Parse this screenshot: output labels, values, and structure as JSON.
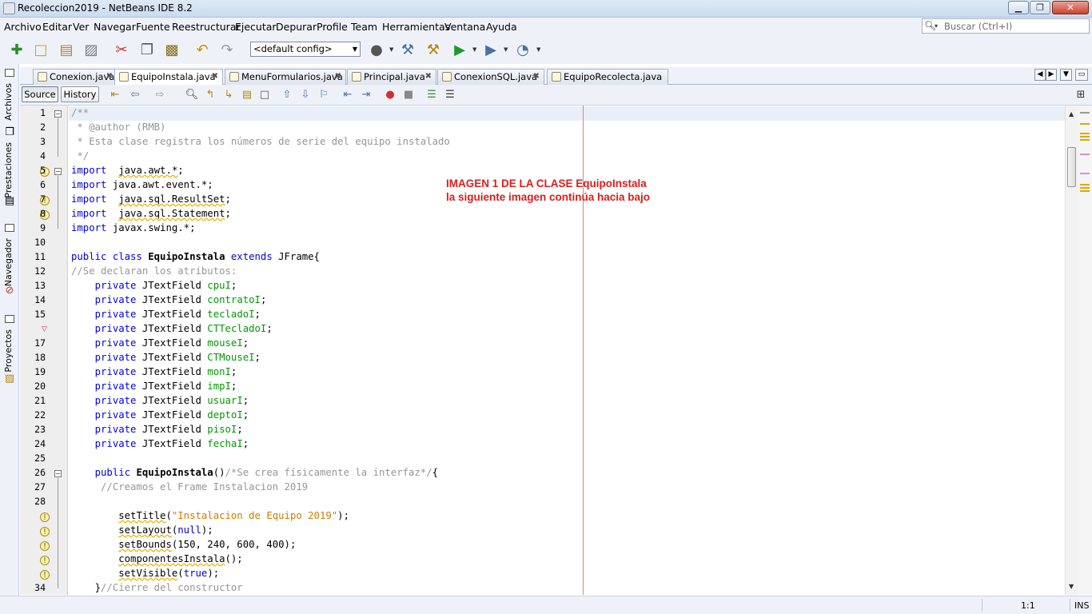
{
  "window": {
    "title": "Recoleccion2019 - NetBeans IDE 8.2",
    "min_label": "▁",
    "max_label": "❐",
    "close_label": "✕"
  },
  "menu": [
    "Archivo",
    "Editar",
    "Ver",
    "Navegar",
    "Fuente",
    "Reestructurar",
    "Ejecutar",
    "Depurar",
    "Profile",
    "Team",
    "Herramientas",
    "Ventana",
    "Ayuda"
  ],
  "search": {
    "placeholder": "Buscar (Ctrl+I)"
  },
  "toolbar": {
    "config": "<default config>"
  },
  "side_tabs": [
    "Archivos",
    "Prestaciones",
    "Navegador",
    "Proyectos"
  ],
  "tabs": [
    {
      "label": "Conexion.java"
    },
    {
      "label": "EquipoInstala.java",
      "active": true
    },
    {
      "label": "MenuFormularios.java"
    },
    {
      "label": "Principal.java"
    },
    {
      "label": "ConexionSQL.java"
    },
    {
      "label": "EquipoRecolecta.java"
    }
  ],
  "editor": {
    "source_label": "Source",
    "history_label": "History"
  },
  "code_lines": [
    {
      "n": "1",
      "t": [
        [
          "cm",
          "/**"
        ]
      ]
    },
    {
      "n": "2",
      "t": [
        [
          "cm",
          " * @author (RMB)"
        ]
      ]
    },
    {
      "n": "3",
      "t": [
        [
          "cm",
          " * Esta clase registra los números de serie del equipo instalado"
        ]
      ]
    },
    {
      "n": "4",
      "t": [
        [
          "cm",
          " */"
        ]
      ]
    },
    {
      "n": "5",
      "t": [
        [
          "kw",
          "import"
        ],
        [
          "",
          "  "
        ],
        [
          "wave",
          "java.awt.*"
        ],
        [
          "",
          ";"
        ]
      ]
    },
    {
      "n": "6",
      "t": [
        [
          "kw",
          "import"
        ],
        [
          "",
          " java.awt.event.*;"
        ]
      ]
    },
    {
      "n": "7",
      "t": [
        [
          "kw",
          "import"
        ],
        [
          "",
          "  "
        ],
        [
          "wave",
          "java.sql.ResultSet"
        ],
        [
          "",
          ";"
        ]
      ]
    },
    {
      "n": "8",
      "t": [
        [
          "kw",
          "import"
        ],
        [
          "",
          "  "
        ],
        [
          "wave",
          "java.sql.Statement"
        ],
        [
          "",
          ";"
        ]
      ]
    },
    {
      "n": "9",
      "t": [
        [
          "kw",
          "import"
        ],
        [
          "",
          " javax.swing.*;"
        ]
      ]
    },
    {
      "n": "10",
      "t": []
    },
    {
      "n": "11",
      "t": [
        [
          "kw",
          "public class "
        ],
        [
          "bold",
          "EquipoInstala"
        ],
        [
          "kw",
          " extends"
        ],
        [
          "",
          " JFrame{"
        ]
      ]
    },
    {
      "n": "12",
      "t": [
        [
          "cm",
          "//Se declaran los atributos:"
        ]
      ]
    },
    {
      "n": "13",
      "t": [
        [
          "",
          "    "
        ],
        [
          "kw",
          "private"
        ],
        [
          "",
          " JTextField "
        ],
        [
          "fld",
          "cpuI"
        ],
        [
          "",
          ";"
        ]
      ]
    },
    {
      "n": "14",
      "t": [
        [
          "",
          "    "
        ],
        [
          "kw",
          "private"
        ],
        [
          "",
          " JTextField "
        ],
        [
          "fld",
          "contratoI"
        ],
        [
          "",
          ";"
        ]
      ]
    },
    {
      "n": "15",
      "t": [
        [
          "",
          "    "
        ],
        [
          "kw",
          "private"
        ],
        [
          "",
          " JTextField "
        ],
        [
          "fld",
          "tecladoI"
        ],
        [
          "",
          ";"
        ]
      ]
    },
    {
      "n": "",
      "t": [
        [
          "",
          "    "
        ],
        [
          "kw",
          "private"
        ],
        [
          "",
          " JTextField "
        ],
        [
          "fld",
          "CTTecladoI"
        ],
        [
          "",
          ";"
        ]
      ]
    },
    {
      "n": "17",
      "t": [
        [
          "",
          "    "
        ],
        [
          "kw",
          "private"
        ],
        [
          "",
          " JTextField "
        ],
        [
          "fld",
          "mouseI"
        ],
        [
          "",
          ";"
        ]
      ]
    },
    {
      "n": "18",
      "t": [
        [
          "",
          "    "
        ],
        [
          "kw",
          "private"
        ],
        [
          "",
          " JTextField "
        ],
        [
          "fld",
          "CTMouseI"
        ],
        [
          "",
          ";"
        ]
      ]
    },
    {
      "n": "19",
      "t": [
        [
          "",
          "    "
        ],
        [
          "kw",
          "private"
        ],
        [
          "",
          " JTextField "
        ],
        [
          "fld",
          "monI"
        ],
        [
          "",
          ";"
        ]
      ]
    },
    {
      "n": "20",
      "t": [
        [
          "",
          "    "
        ],
        [
          "kw",
          "private"
        ],
        [
          "",
          " JTextField "
        ],
        [
          "fld",
          "impI"
        ],
        [
          "",
          ";"
        ]
      ]
    },
    {
      "n": "21",
      "t": [
        [
          "",
          "    "
        ],
        [
          "kw",
          "private"
        ],
        [
          "",
          " JTextField "
        ],
        [
          "fld",
          "usuarI"
        ],
        [
          "",
          ";"
        ]
      ]
    },
    {
      "n": "22",
      "t": [
        [
          "",
          "    "
        ],
        [
          "kw",
          "private"
        ],
        [
          "",
          " JTextField "
        ],
        [
          "fld",
          "deptoI"
        ],
        [
          "",
          ";"
        ]
      ]
    },
    {
      "n": "23",
      "t": [
        [
          "",
          "    "
        ],
        [
          "kw",
          "private"
        ],
        [
          "",
          " JTextField "
        ],
        [
          "fld",
          "pisoI"
        ],
        [
          "",
          ";"
        ]
      ]
    },
    {
      "n": "24",
      "t": [
        [
          "",
          "    "
        ],
        [
          "kw",
          "private"
        ],
        [
          "",
          " JTextField "
        ],
        [
          "fld",
          "fechaI"
        ],
        [
          "",
          ";"
        ]
      ]
    },
    {
      "n": "25",
      "t": []
    },
    {
      "n": "26",
      "t": [
        [
          "",
          "    "
        ],
        [
          "kw",
          "public"
        ],
        [
          " bold",
          " EquipoInstala"
        ],
        [
          "",
          "()"
        ],
        [
          "cm",
          "/*Se crea físicamente la interfaz*/"
        ],
        [
          "",
          "{"
        ]
      ]
    },
    {
      "n": "27",
      "t": [
        [
          "cm",
          "     //Creamos el Frame Instalacion 2019"
        ]
      ]
    },
    {
      "n": "28",
      "t": []
    },
    {
      "n": "",
      "t": [
        [
          "",
          "        "
        ],
        [
          "wave",
          "setTitle"
        ],
        [
          "",
          "("
        ],
        [
          "str",
          "\"Instalacion de Equipo 2019\""
        ],
        [
          "",
          ");"
        ]
      ]
    },
    {
      "n": "",
      "t": [
        [
          "",
          "        "
        ],
        [
          "wave",
          "setLayout"
        ],
        [
          "",
          "("
        ],
        [
          "kw",
          "null"
        ],
        [
          "",
          ");"
        ]
      ]
    },
    {
      "n": "",
      "t": [
        [
          "",
          "        "
        ],
        [
          "wave",
          "setBounds"
        ],
        [
          "",
          "(150, 240, 600, 400);"
        ]
      ]
    },
    {
      "n": "",
      "t": [
        [
          "",
          "        "
        ],
        [
          "wave",
          "componentesInstala"
        ],
        [
          "",
          "();"
        ]
      ]
    },
    {
      "n": "",
      "t": [
        [
          "",
          "        "
        ],
        [
          "wave",
          "setVisible"
        ],
        [
          "",
          "("
        ],
        [
          "kw",
          "true"
        ],
        [
          "",
          ");"
        ]
      ]
    },
    {
      "n": "34",
      "t": [
        [
          "",
          "    }"
        ],
        [
          "cm",
          "//Cierre del constructor"
        ]
      ]
    }
  ],
  "annotation": {
    "line1": "IMAGEN 1 DE LA CLASE EquipoInstala",
    "line2": "la siguiente imagen continúa hacia bajo"
  },
  "status": {
    "position": "1:1",
    "mode": "INS"
  },
  "colors": {
    "keyword": "#0000e6",
    "comment": "#969696",
    "field": "#009900",
    "string": "#ce7b00",
    "annotation": "#e01b1b",
    "margin_line": "#e57e7e"
  }
}
